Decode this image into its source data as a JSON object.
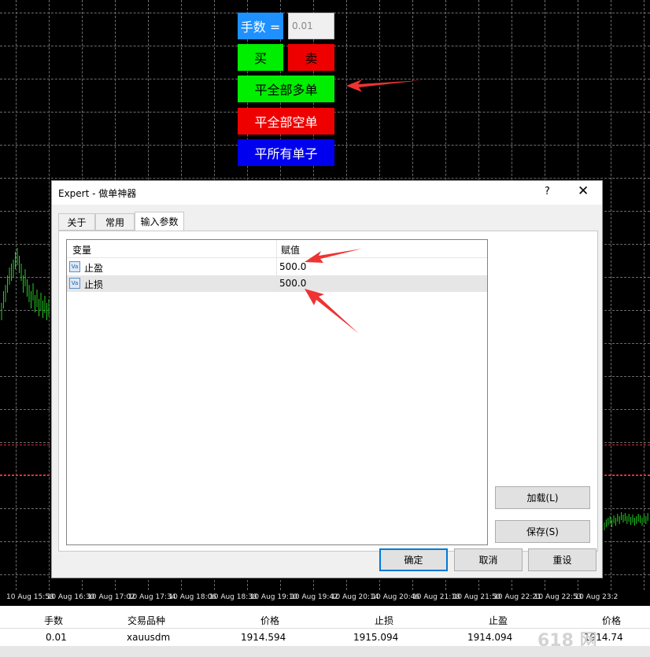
{
  "trade_panel": {
    "lots_label": "手数 =",
    "lots_value": "0.01",
    "buy_label": "买",
    "sell_label": "卖",
    "close_all_long_label": "平全部多单",
    "close_all_short_label": "平全部空单",
    "close_all_orders_label": "平所有单子",
    "colors": {
      "lots_label_bg": "#1e90ff",
      "buy_bg": "#00ee00",
      "sell_bg": "#ee0000",
      "close_long_bg": "#00ee00",
      "close_short_bg": "#ee0000",
      "close_all_bg": "#0000ee"
    }
  },
  "time_axis": {
    "ticks": [
      "10 Aug 15:58",
      "10 Aug 16:30",
      "10 Aug 17:02",
      "10 Aug 17:34",
      "10 Aug 18:06",
      "10 Aug 18:38",
      "10 Aug 19:10",
      "10 Aug 19:42",
      "10 Aug 20:14",
      "10 Aug 20:46",
      "10 Aug 21:18",
      "10 Aug 21:50",
      "10 Aug 22:21",
      "10 Aug 22:53",
      "10 Aug 23:2"
    ]
  },
  "dialog": {
    "title": "Expert - 做单神器",
    "help_icon": "?",
    "close_icon": "✕",
    "tabs": [
      {
        "label": "关于",
        "active": false
      },
      {
        "label": "常用",
        "active": false
      },
      {
        "label": "输入参数",
        "active": true
      }
    ],
    "grid": {
      "col_variable": "变量",
      "col_value": "赋值",
      "rows": [
        {
          "variable": "止盈",
          "value": "500.0",
          "icon": "variable-icon",
          "icon_text": "Va"
        },
        {
          "variable": "止损",
          "value": "500.0",
          "icon": "variable-icon",
          "icon_text": "Va"
        }
      ]
    },
    "load_button": "加载(L)",
    "save_button": "保存(S)",
    "ok_button": "确定",
    "cancel_button": "取消",
    "reset_button": "重设"
  },
  "positions_table": {
    "headers": [
      "手数",
      "交易品种",
      "价格",
      "止损",
      "止盈",
      "价格"
    ],
    "row": [
      "0.01",
      "xauusdm",
      "1914.594",
      "1915.094",
      "1914.094",
      "1914.74"
    ]
  },
  "watermark": "618 网",
  "colors": {
    "chart_bg": "#000000",
    "candle_color": "#1fd01f",
    "sl_tp_line": "#d23030",
    "annotation_arrow": "#ee3333"
  }
}
